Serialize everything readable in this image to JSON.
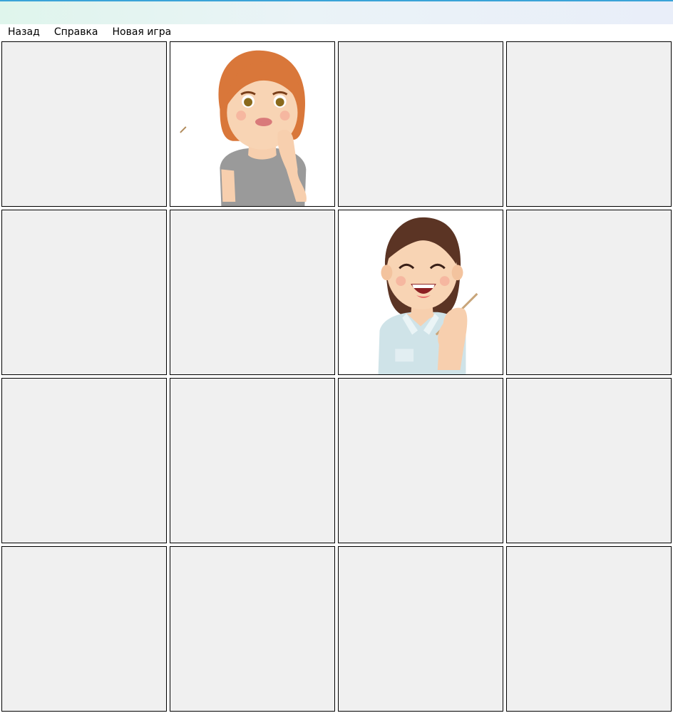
{
  "window": {
    "title": ""
  },
  "menu": {
    "items": [
      {
        "label": "Назад"
      },
      {
        "label": "Справка"
      },
      {
        "label": "Новая игра"
      }
    ]
  },
  "board": {
    "rows": 4,
    "cols": 4,
    "cells": [
      {
        "state": "hidden"
      },
      {
        "state": "revealed",
        "picture": "woman-red-hair-icon"
      },
      {
        "state": "hidden"
      },
      {
        "state": "hidden"
      },
      {
        "state": "hidden"
      },
      {
        "state": "hidden"
      },
      {
        "state": "revealed",
        "picture": "woman-brown-hair-laughing-icon"
      },
      {
        "state": "hidden"
      },
      {
        "state": "hidden"
      },
      {
        "state": "hidden"
      },
      {
        "state": "hidden"
      },
      {
        "state": "hidden"
      },
      {
        "state": "hidden"
      },
      {
        "state": "hidden"
      },
      {
        "state": "hidden"
      },
      {
        "state": "hidden"
      }
    ],
    "colors": {
      "hidden_card": "#f0f0f0",
      "revealed_card": "#ffffff",
      "border": "#000000"
    }
  }
}
